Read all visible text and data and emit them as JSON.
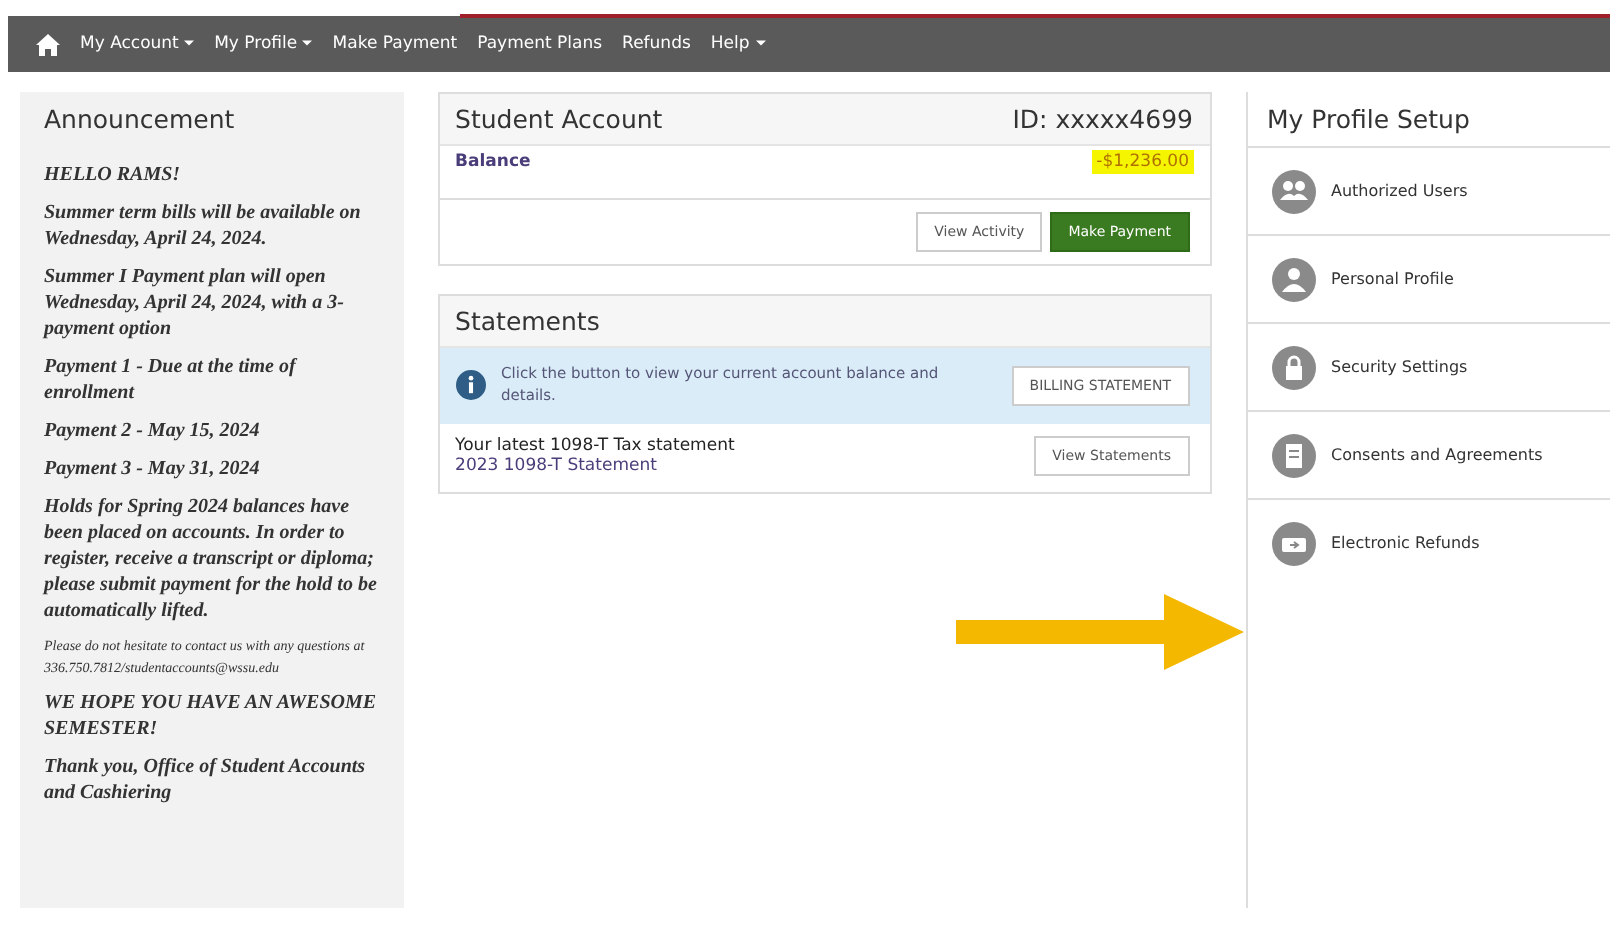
{
  "nav": {
    "items": [
      {
        "label": "My Account",
        "dropdown": true
      },
      {
        "label": "My Profile",
        "dropdown": true
      },
      {
        "label": "Make Payment",
        "dropdown": false
      },
      {
        "label": "Payment Plans",
        "dropdown": false
      },
      {
        "label": "Refunds",
        "dropdown": false
      },
      {
        "label": "Help",
        "dropdown": true
      }
    ]
  },
  "announcement": {
    "title": "Announcement",
    "paragraphs": [
      {
        "kind": "body",
        "text": "HELLO RAMS!"
      },
      {
        "kind": "body",
        "text": "Summer term bills will be available on Wednesday, April 24, 2024."
      },
      {
        "kind": "body",
        "text": "Summer I Payment plan will open Wednesday, April 24, 2024, with a 3-payment option"
      },
      {
        "kind": "body",
        "text": "Payment 1 - Due at the time of enrollment"
      },
      {
        "kind": "body",
        "text": "Payment 2 - May 15, 2024"
      },
      {
        "kind": "body",
        "text": "Payment 3 - May 31, 2024"
      },
      {
        "kind": "body",
        "text": "Holds for Spring 2024 balances have been placed on accounts. In order to register,  receive a transcript or diploma; please submit payment for the hold to be automatically lifted."
      },
      {
        "kind": "small",
        "text": "Please do not hesitate to contact us with any questions at 336.750.7812/studentaccounts@wssu.edu"
      },
      {
        "kind": "body",
        "text": "WE HOPE YOU HAVE AN AWESOME SEMESTER!"
      },
      {
        "kind": "body",
        "text": "Thank you, Office of Student Accounts and Cashiering"
      }
    ]
  },
  "student_account": {
    "title": "Student Account",
    "id": "ID: xxxxx4699",
    "balance_label": "Balance",
    "balance": "-$1,236.00",
    "buttons": [
      {
        "label": "View Activity",
        "kind": "default"
      },
      {
        "label": "Make Payment",
        "kind": "primary"
      }
    ]
  },
  "statements": {
    "title": "Statements",
    "info": "Click the button to view your current account balance and details.",
    "info_button": "BILLING STATEMENT",
    "tax_heading": "Your latest 1098-T Tax statement",
    "tax_link": "2023 1098-T Statement",
    "tax_button": "View Statements"
  },
  "profile_setup": {
    "title": "My Profile Setup",
    "items": [
      {
        "label": "Authorized Users",
        "kind": "users"
      },
      {
        "label": "Personal Profile",
        "kind": "person"
      },
      {
        "label": "Security Settings",
        "kind": "lock"
      },
      {
        "label": "Consents and Agreements",
        "kind": "document"
      },
      {
        "label": "Electronic Refunds",
        "kind": "refund"
      }
    ]
  }
}
